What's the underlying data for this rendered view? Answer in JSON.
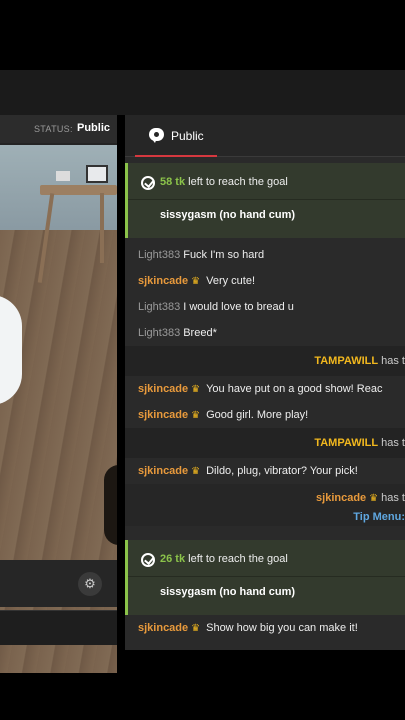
{
  "video": {
    "status_label": "STATUS:",
    "status_value": "Public",
    "settings_icon": "gear-icon"
  },
  "chat": {
    "tab_label": "Public",
    "tab_icon": "chat-bubble-icon",
    "goal1": {
      "amount": "58 tk",
      "text": "left to reach the goal",
      "name": "sissygasm (no hand cum)"
    },
    "messages_a": [
      {
        "user": "Light383",
        "text": "Fuck I'm so hard"
      },
      {
        "user": "sjkincade",
        "text": "Very cute!"
      },
      {
        "user": "Light383",
        "text": "I would love to bread u"
      },
      {
        "user": "Light383",
        "text": "Breed*"
      }
    ],
    "system1": {
      "user": "TAMPAWILL",
      "text": "has t"
    },
    "messages_b": [
      {
        "user": "sjkincade",
        "text": "You have put on a good show! Reac"
      },
      {
        "user": "sjkincade",
        "text": "Good girl. More play!"
      }
    ],
    "system2": {
      "user": "TAMPAWILL",
      "text": "has t"
    },
    "messages_c": [
      {
        "user": "sjkincade",
        "text": "Dildo, plug, vibrator? Your pick!"
      }
    ],
    "tip": {
      "user": "sjkincade",
      "text": "has t",
      "menu_label": "Tip Menu:"
    },
    "goal2": {
      "amount": "26 tk",
      "text": "left to reach the goal",
      "name": "sissygasm (no hand cum)"
    },
    "messages_d": [
      {
        "user": "sjkincade",
        "text": "Show how big you can make it!"
      }
    ]
  },
  "colors": {
    "goal_accent": "#8bc34a",
    "username_gold": "#e89a3c",
    "crown": "#f2b81e",
    "tab_underline": "#d6383f",
    "tip_menu": "#5fa7e0"
  }
}
